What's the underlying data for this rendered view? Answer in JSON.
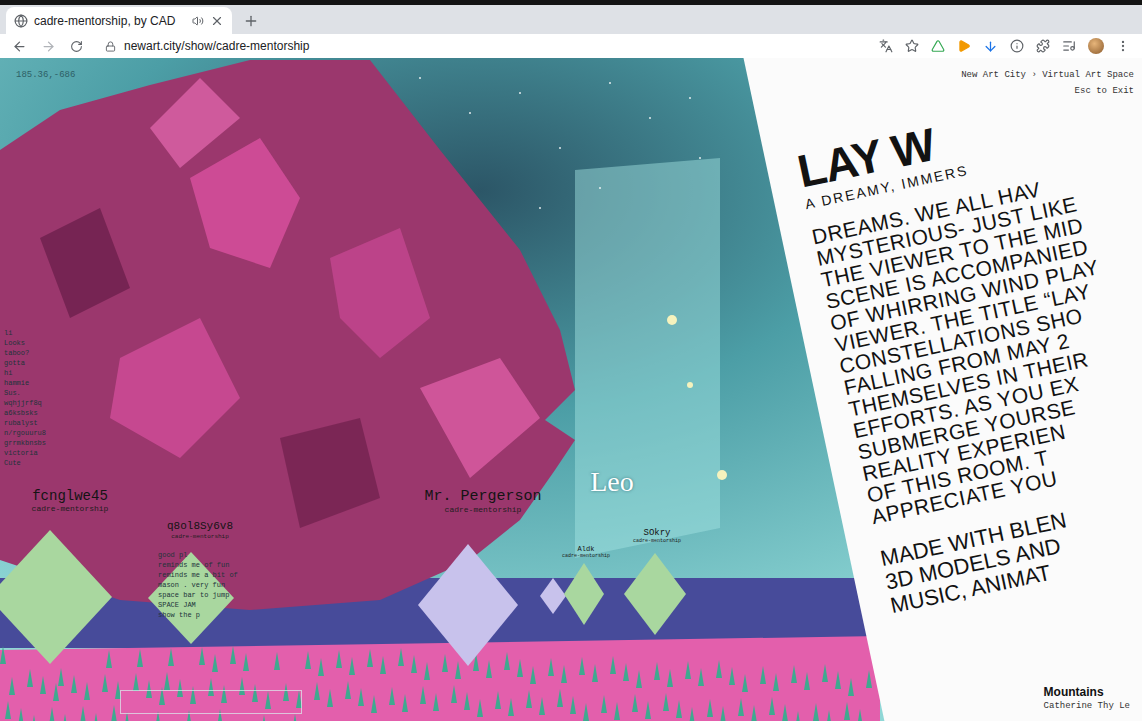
{
  "browser": {
    "tabs": [
      {
        "title": "cadre-mentorship, by CAD",
        "selected": true,
        "audio": true
      }
    ],
    "url": "newart.city/show/cadre-mentorship"
  },
  "hud": {
    "coords": "185.36,-686",
    "breadcrumb": "New Art City › Virtual Art Space",
    "exit": "Esc to Exit"
  },
  "avatars": [
    {
      "name": "fcnglwe45",
      "subtitle": "cadre-mentorship",
      "color": "#a9d79f",
      "kind": "visitor"
    },
    {
      "name": "q8ol8Sy6v8",
      "subtitle": "cadre-mentorship",
      "color": "#a9d79f",
      "kind": "visitor"
    },
    {
      "name": "Mr. Pergerson",
      "subtitle": "cadre-mentorship",
      "color": "#c8c2ec",
      "kind": "visitor"
    },
    {
      "name": "Leo",
      "color": "#c8c2ec",
      "kind": "self"
    },
    {
      "name": "Aldk",
      "subtitle": "cadre-mentorship",
      "color": "#a9d79f",
      "kind": "visitor"
    },
    {
      "name": "SOkry",
      "subtitle": "cadre-mentorship",
      "color": "#a9d79f",
      "kind": "visitor"
    }
  ],
  "chat": {
    "history": [
      "li",
      "Looks",
      "taboo?",
      "gotta",
      "hi",
      "hammie",
      "Sus.",
      "wqhjjrf8q",
      "a6ksbsks",
      "rubalyst",
      "n/rgouuru8",
      "grrmkbnsbs",
      "victoria",
      "Cute"
    ],
    "recent": [
      "good pl",
      "reminds me of fun",
      "reminds me a bit of",
      "mason . very fun",
      "space bar to jump",
      "SPACE JAM",
      "show the p"
    ]
  },
  "poster": {
    "title": "LAY W",
    "subtitle": "A DREAMY, IMMERS",
    "lines": [
      "DREAMS. WE ALL HAV",
      "MYSTERIOUS- JUST LIKE",
      "THE VIEWER TO THE MID",
      "SCENE IS ACCOMPANIED",
      "OF WHIRRING WIND PLAY",
      "VIEWER. THE TITLE “LAY",
      "CONSTELLATIONS SHO",
      "FALLING FROM MAY 2",
      "THEMSELVES IN THEIR",
      "EFFORTS. AS YOU EX",
      "SUBMERGE YOURSE",
      "REALITY EXPERIEN",
      "OF THIS ROOM. T",
      "APPRECIATE YOU"
    ],
    "credits": [
      "MADE WITH BLEN",
      "3D MODELS AND",
      "MUSIC, ANIMAT"
    ]
  },
  "artwork": {
    "title": "Mountains",
    "artist": "Catherine Thy Le"
  }
}
